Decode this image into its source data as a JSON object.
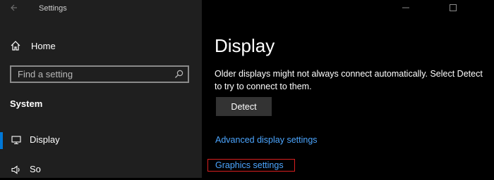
{
  "window": {
    "title": "Settings",
    "back_icon": "back-arrow-icon",
    "controls": [
      "minimize-icon",
      "maximize-icon"
    ]
  },
  "sidebar": {
    "home": {
      "label": "Home",
      "icon": "home-icon"
    },
    "search": {
      "placeholder": "Find a setting",
      "icon": "search-icon"
    },
    "group_heading": "System",
    "items": [
      {
        "label": "Display",
        "icon": "monitor-icon",
        "selected": true
      },
      {
        "label": "So",
        "icon": "speaker-icon",
        "selected": false
      }
    ]
  },
  "main": {
    "title": "Display",
    "description": "Older displays might not always connect automatically. Select Detect to try to connect to them.",
    "detect_button": "Detect",
    "links": {
      "advanced": "Advanced display settings",
      "graphics": "Graphics settings"
    }
  },
  "colors": {
    "accent": "#0078d7",
    "link": "#4ca6ff",
    "highlight": "#d91f1f",
    "sidebar_bg": "#1f1f1f",
    "main_bg": "#000000"
  }
}
